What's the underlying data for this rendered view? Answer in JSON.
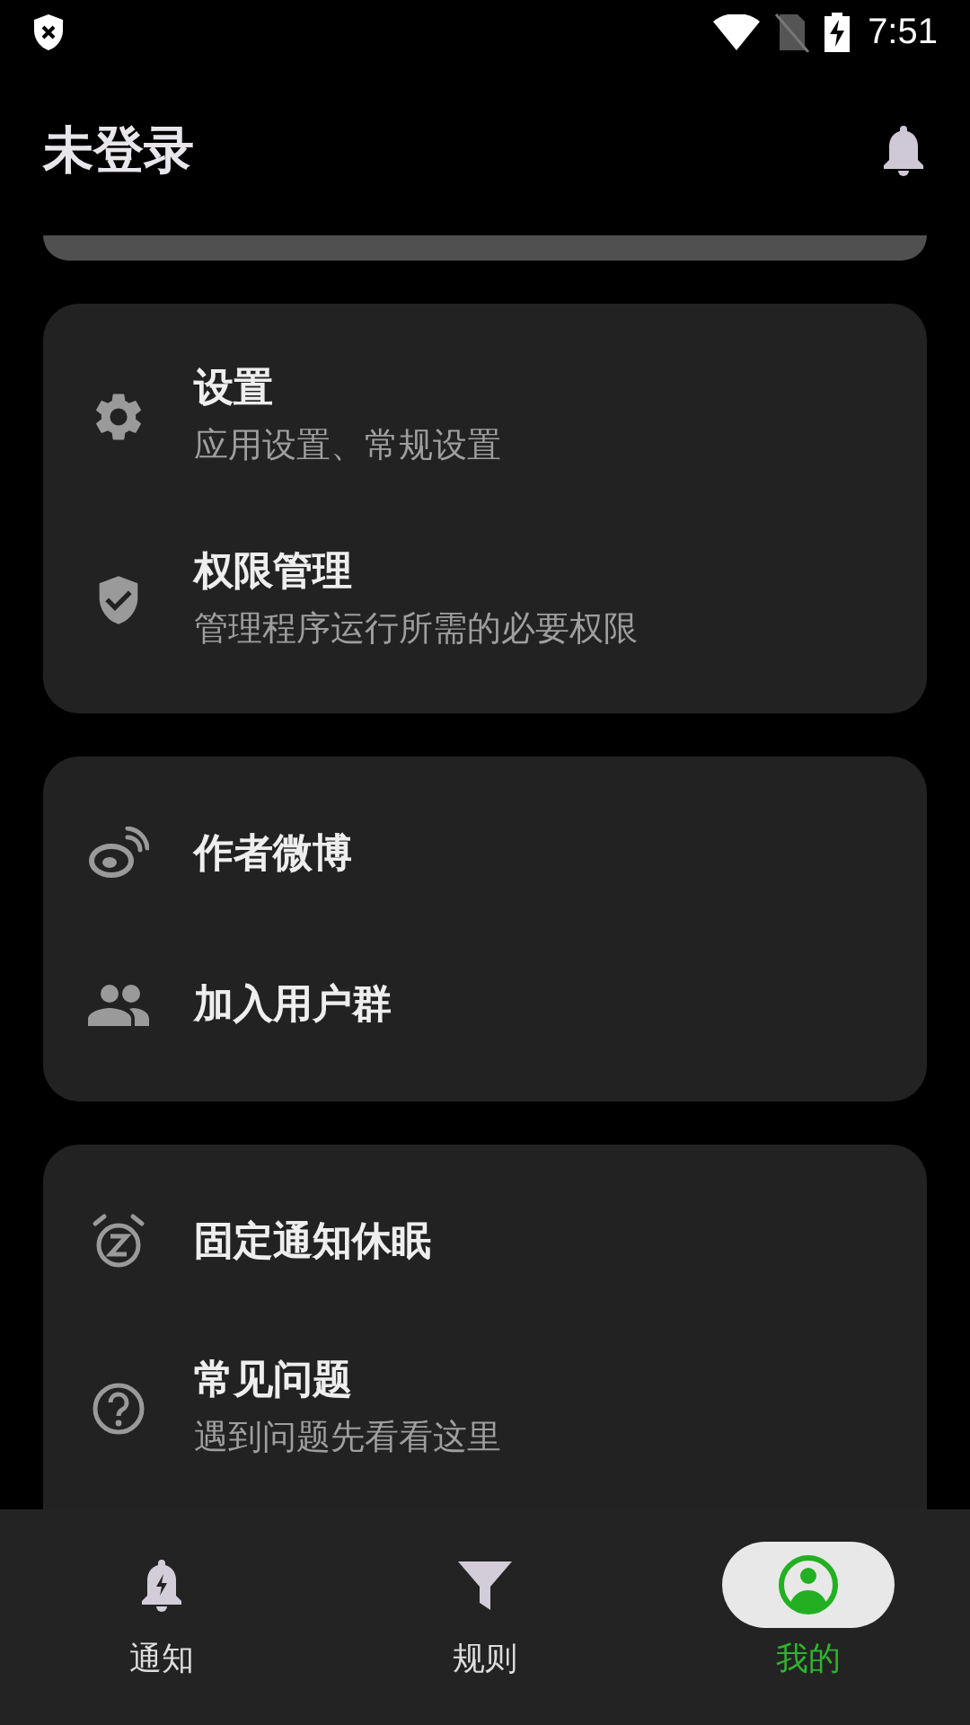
{
  "status_bar": {
    "time": "7:51"
  },
  "header": {
    "title": "未登录"
  },
  "groups": [
    {
      "items": [
        {
          "title": "设置",
          "subtitle": "应用设置、常规设置"
        },
        {
          "title": "权限管理",
          "subtitle": "管理程序运行所需的必要权限"
        }
      ]
    },
    {
      "items": [
        {
          "title": "作者微博"
        },
        {
          "title": "加入用户群"
        }
      ]
    },
    {
      "items": [
        {
          "title": "固定通知休眠"
        },
        {
          "title": "常见问题",
          "subtitle": "遇到问题先看看这里"
        }
      ]
    }
  ],
  "bottom_nav": [
    {
      "label": "通知",
      "selected": false
    },
    {
      "label": "规则",
      "selected": false
    },
    {
      "label": "我的",
      "selected": true
    }
  ]
}
